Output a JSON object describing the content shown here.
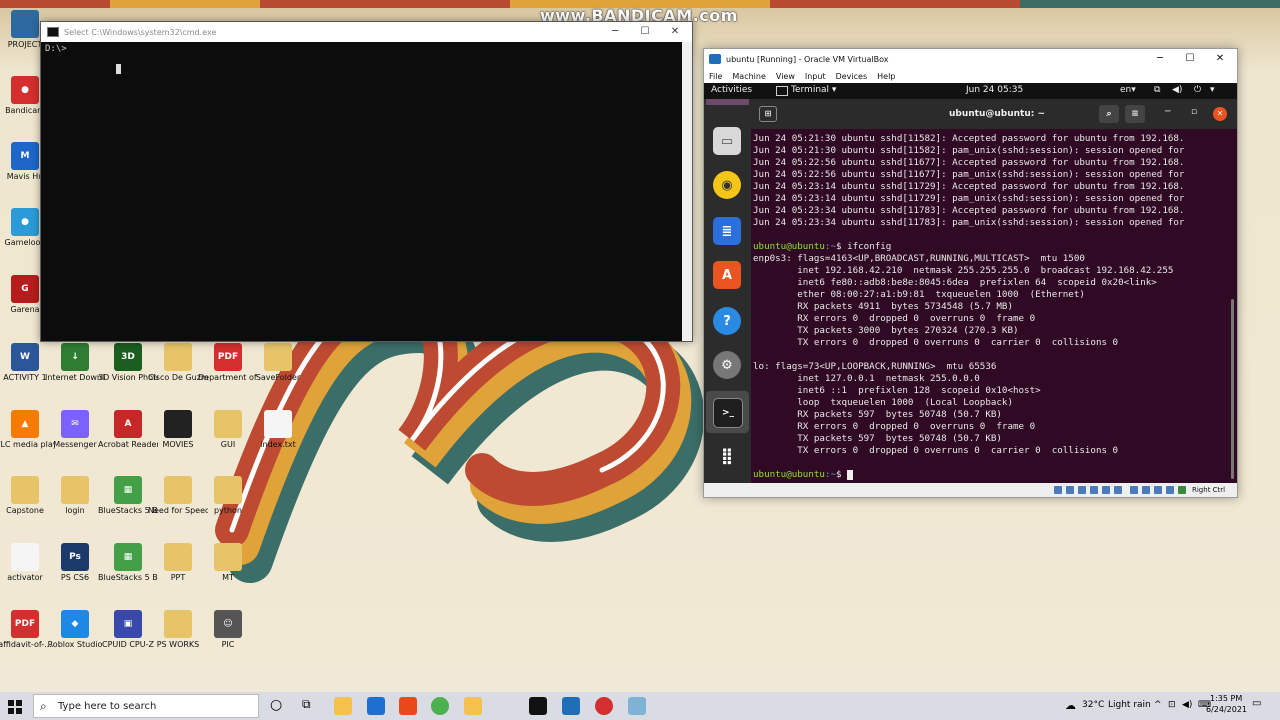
{
  "watermark": "www.BANDICAM.com",
  "desktop_icons": [
    {
      "label": "PROJECT",
      "color": "#2d6a9f",
      "glyph": ""
    },
    {
      "label": "Bandicam",
      "color": "#d32f2f",
      "glyph": "●"
    },
    {
      "label": "Mavis Hu",
      "color": "#1e66c9",
      "glyph": "M"
    },
    {
      "label": "Gameloop",
      "color": "#2a9bd8",
      "glyph": "●"
    },
    {
      "label": "Garena",
      "color": "#b71c1c",
      "glyph": "G"
    },
    {
      "label": "ACTIVITY 1",
      "color": "#2b579a",
      "glyph": "W"
    },
    {
      "label": "Internet Downlo...",
      "color": "#2e7d32",
      "glyph": "↓"
    },
    {
      "label": "3D Vision Photo Viewer",
      "color": "#1b5e20",
      "glyph": "3D"
    },
    {
      "label": "Cisco De Guzma...",
      "color": "#e8c468",
      "glyph": ""
    },
    {
      "label": "Department of Foreign...",
      "color": "#d32f2f",
      "glyph": "PDF"
    },
    {
      "label": "SaveFolder",
      "color": "#e8c468",
      "glyph": ""
    },
    {
      "label": "VLC media player",
      "color": "#f57c00",
      "glyph": "▲"
    },
    {
      "label": "Messenger",
      "color": "#7b61ff",
      "glyph": "✉"
    },
    {
      "label": "Acrobat Reader DC",
      "color": "#c62828",
      "glyph": "A"
    },
    {
      "label": "MOVIES",
      "color": "#222",
      "glyph": ""
    },
    {
      "label": "GUI",
      "color": "#e8c468",
      "glyph": ""
    },
    {
      "label": "index.txt",
      "color": "#f5f5f5",
      "glyph": ""
    },
    {
      "label": "Capstone",
      "color": "#e8c468",
      "glyph": ""
    },
    {
      "label": "login",
      "color": "#e8c468",
      "glyph": ""
    },
    {
      "label": "BlueStacks 5 Beta Multi-I...",
      "color": "#43a047",
      "glyph": "▦"
    },
    {
      "label": "Need for Speed Mo...",
      "color": "#e8c468",
      "glyph": ""
    },
    {
      "label": "python",
      "color": "#e8c468",
      "glyph": ""
    },
    {
      "label": "activator",
      "color": "#f5f5f5",
      "glyph": ""
    },
    {
      "label": "PS CS6",
      "color": "#1a3a6b",
      "glyph": "Ps"
    },
    {
      "label": "BlueStacks 5 Beta",
      "color": "#43a047",
      "glyph": "▦"
    },
    {
      "label": "PPT",
      "color": "#e8c468",
      "glyph": ""
    },
    {
      "label": "MT",
      "color": "#e8c468",
      "glyph": ""
    },
    {
      "label": "affidavit-of-...",
      "color": "#d32f2f",
      "glyph": "PDF"
    },
    {
      "label": "Roblox Studio",
      "color": "#1e88e5",
      "glyph": "◆"
    },
    {
      "label": "CPUID CPU-Z",
      "color": "#3949ab",
      "glyph": "▣"
    },
    {
      "label": "PS WORKS",
      "color": "#e8c468",
      "glyph": ""
    },
    {
      "label": "PIC",
      "color": "#555",
      "glyph": "☺"
    }
  ],
  "cmd": {
    "title": "Select C:\\Windows\\system32\\cmd.exe",
    "prompt": "D:\\>"
  },
  "vbox": {
    "title": "ubuntu [Running] - Oracle VM VirtualBox",
    "menu": [
      "File",
      "Machine",
      "View",
      "Input",
      "Devices",
      "Help"
    ],
    "status_host_key": "Right Ctrl"
  },
  "ubuntu": {
    "activities": "Activities",
    "app_menu": "Terminal ▾",
    "clock": "Jun 24  05:35",
    "lang": "en▾",
    "terminal_title": "ubuntu@ubuntu: ~",
    "log_lines": [
      "Jun 24 05:21:30 ubuntu sshd[11582]: Accepted password for ubuntu from 192.168.",
      "Jun 24 05:21:30 ubuntu sshd[11582]: pam_unix(sshd:session): session opened for",
      "Jun 24 05:22:56 ubuntu sshd[11677]: Accepted password for ubuntu from 192.168.",
      "Jun 24 05:22:56 ubuntu sshd[11677]: pam_unix(sshd:session): session opened for",
      "Jun 24 05:23:14 ubuntu sshd[11729]: Accepted password for ubuntu from 192.168.",
      "Jun 24 05:23:14 ubuntu sshd[11729]: pam_unix(sshd:session): session opened for",
      "Jun 24 05:23:34 ubuntu sshd[11783]: Accepted password for ubuntu from 192.168.",
      "Jun 24 05:23:34 ubuntu sshd[11783]: pam_unix(sshd:session): session opened for"
    ],
    "prompt_user": "ubuntu@ubuntu",
    "prompt_path": ":~",
    "prompt_sym": "$ ",
    "command": "ifconfig",
    "ifconfig_lines": [
      "enp0s3: flags=4163<UP,BROADCAST,RUNNING,MULTICAST>  mtu 1500",
      "        inet 192.168.42.210  netmask 255.255.255.0  broadcast 192.168.42.255",
      "        inet6 fe80::adb8:be8e:8045:6dea  prefixlen 64  scopeid 0x20<link>",
      "        ether 08:00:27:a1:b9:81  txqueuelen 1000  (Ethernet)",
      "        RX packets 4911  bytes 5734548 (5.7 MB)",
      "        RX errors 0  dropped 0  overruns 0  frame 0",
      "        TX packets 3000  bytes 270324 (270.3 KB)",
      "        TX errors 0  dropped 0 overruns 0  carrier 0  collisions 0",
      "",
      "lo: flags=73<UP,LOOPBACK,RUNNING>  mtu 65536",
      "        inet 127.0.0.1  netmask 255.0.0.0",
      "        inet6 ::1  prefixlen 128  scopeid 0x10<host>",
      "        loop  txqueuelen 1000  (Local Loopback)",
      "        RX packets 597  bytes 50748 (50.7 KB)",
      "        RX errors 0  dropped 0  overruns 0  frame 0",
      "        TX packets 597  bytes 50748 (50.7 KB)",
      "        TX errors 0  dropped 0 overruns 0  carrier 0  collisions 0"
    ]
  },
  "taskbar": {
    "search_placeholder": "Type here to search",
    "weather_temp": "32°C",
    "weather_desc": "Light rain",
    "time": "1:35 PM",
    "date": "6/24/2021"
  }
}
